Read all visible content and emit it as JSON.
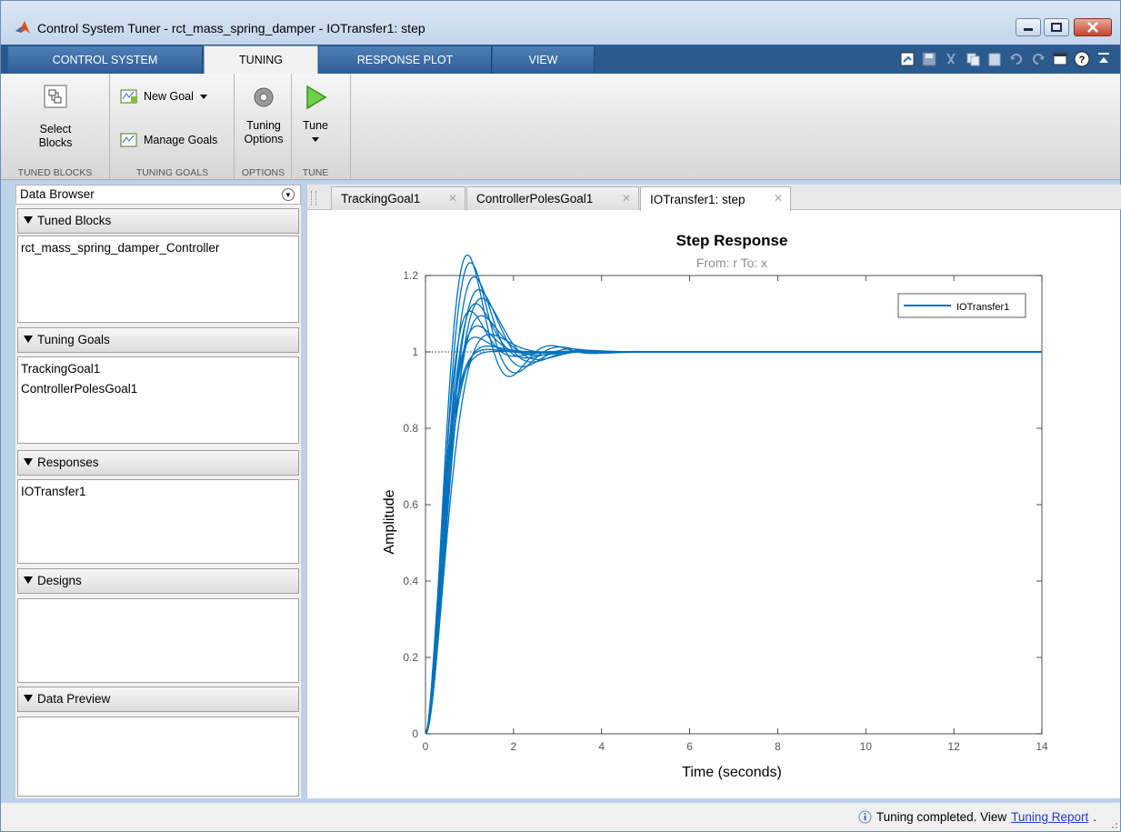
{
  "window": {
    "title": "Control System Tuner - rct_mass_spring_damper - IOTransfer1: step"
  },
  "tabs": [
    {
      "label": "CONTROL SYSTEM",
      "active": false
    },
    {
      "label": "TUNING",
      "active": true
    },
    {
      "label": "RESPONSE PLOT",
      "active": false
    },
    {
      "label": "VIEW",
      "active": false
    }
  ],
  "ribbon": {
    "select_blocks": "Select\nBlocks",
    "select_blocks_1": "Select",
    "select_blocks_2": "Blocks",
    "new_goal": "New Goal",
    "manage_goals": "Manage Goals",
    "tuning_options_1": "Tuning",
    "tuning_options_2": "Options",
    "tune": "Tune",
    "groups": {
      "tuned_blocks": "TUNED BLOCKS",
      "tuning_goals": "TUNING GOALS",
      "options": "OPTIONS",
      "tune": "TUNE"
    }
  },
  "browser": {
    "title": "Data Browser",
    "sections": {
      "tuned_blocks": {
        "label": "Tuned Blocks",
        "items": [
          "rct_mass_spring_damper_Controller"
        ]
      },
      "tuning_goals": {
        "label": "Tuning Goals",
        "items": [
          "TrackingGoal1",
          "ControllerPolesGoal1"
        ]
      },
      "responses": {
        "label": "Responses",
        "items": [
          "IOTransfer1"
        ]
      },
      "designs": {
        "label": "Designs",
        "items": []
      },
      "data_preview": {
        "label": "Data Preview",
        "items": []
      }
    }
  },
  "doc_tabs": [
    {
      "label": "TrackingGoal1",
      "active": false
    },
    {
      "label": "ControllerPolesGoal1",
      "active": false
    },
    {
      "label": "IOTransfer1: step",
      "active": true
    }
  ],
  "chart_data": {
    "type": "line",
    "title": "Step Response",
    "subtitle": "From: r  To: x",
    "xlabel": "Time (seconds)",
    "ylabel": "Amplitude",
    "xlim": [
      0,
      14
    ],
    "ylim": [
      0,
      1.2
    ],
    "xticks": [
      "0",
      "2",
      "4",
      "6",
      "8",
      "10",
      "12",
      "14"
    ],
    "yticks": [
      "0",
      "0.2",
      "0.4",
      "0.6",
      "0.8",
      "1",
      "1.2"
    ],
    "reference_line": 1,
    "legend": {
      "entries": [
        "IOTransfer1"
      ],
      "placement": "top-right"
    },
    "series": [
      {
        "name": "IOTransfer1",
        "color": "#0072bd",
        "family": [
          {
            "wn": 3.4,
            "zeta": 0.42
          },
          {
            "wn": 3.2,
            "zeta": 0.46
          },
          {
            "wn": 3.0,
            "zeta": 0.5
          },
          {
            "wn": 2.9,
            "zeta": 0.53
          },
          {
            "wn": 3.6,
            "zeta": 0.4
          },
          {
            "wn": 3.3,
            "zeta": 0.55
          },
          {
            "wn": 3.1,
            "zeta": 0.6
          },
          {
            "wn": 3.8,
            "zeta": 0.58
          },
          {
            "wn": 3.5,
            "zeta": 0.65
          },
          {
            "wn": 3.0,
            "zeta": 0.7
          },
          {
            "wn": 4.0,
            "zeta": 0.72
          },
          {
            "wn": 3.7,
            "zeta": 0.8
          },
          {
            "wn": 4.2,
            "zeta": 0.85
          },
          {
            "wn": 4.4,
            "zeta": 0.9
          }
        ]
      }
    ]
  },
  "status": {
    "message": "Tuning completed. View",
    "link": "Tuning Report",
    "suffix": "."
  }
}
